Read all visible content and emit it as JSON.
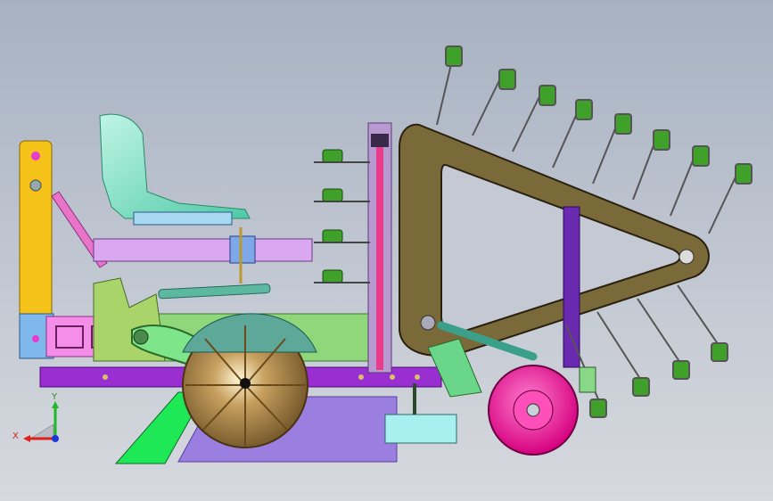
{
  "triad": {
    "x_label": "X",
    "y_label": "Y",
    "x_color": "#e0201c",
    "y_color": "#1fb82a",
    "z_color": "#1e37d6"
  },
  "colors": {
    "background_top": "#a7b1c2",
    "background_bottom": "#d6d9de",
    "conveyor_frame": "#7a6a3a",
    "main_frame_beam": "#9a2fd1",
    "seat": "#7fe0c4",
    "wheel_tire": "#f21aa6",
    "drum_bronze": "#a8824a",
    "green_base": "#8fd77a",
    "yellow_post": "#f5c21a"
  },
  "icons": {
    "view_triad": "axis-triad-icon"
  }
}
